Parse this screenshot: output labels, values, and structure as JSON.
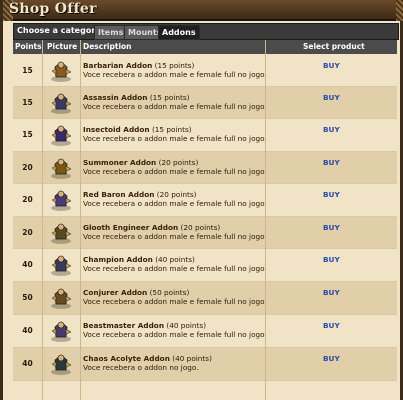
{
  "window": {
    "title": "Shop Offer"
  },
  "categories": {
    "label": "Choose a categorie:",
    "tabs": [
      {
        "label": "Items",
        "active": false
      },
      {
        "label": "Mounts",
        "active": false
      },
      {
        "label": "Addons",
        "active": true
      }
    ]
  },
  "table": {
    "headers": {
      "points": "Points",
      "picture": "Picture",
      "description": "Description",
      "select": "Select product"
    },
    "rows": [
      {
        "points": "15",
        "name": "Barbarian Addon",
        "pts_text": "(15 points)",
        "desc": "Voce recebera o addon male e female full no jogo.",
        "buy": "BUY",
        "icon": "barbarian-outfit-icon"
      },
      {
        "points": "15",
        "name": "Assassin Addon",
        "pts_text": "(15 points)",
        "desc": "Voce recebera o addon male e female full no jogo.",
        "buy": "BUY",
        "icon": "assassin-outfit-icon"
      },
      {
        "points": "15",
        "name": "Insectoid Addon",
        "pts_text": "(15 points)",
        "desc": "Voce recebera o addon male e female full no jogo.",
        "buy": "BUY",
        "icon": "insectoid-outfit-icon"
      },
      {
        "points": "20",
        "name": "Summoner Addon",
        "pts_text": "(20 points)",
        "desc": "Voce recebera o addon male e female full no jogo.",
        "buy": "BUY",
        "icon": "summoner-outfit-icon"
      },
      {
        "points": "20",
        "name": "Red Baron Addon",
        "pts_text": "(20 points)",
        "desc": "Voce recebera o addon male e female full no jogo.",
        "buy": "BUY",
        "icon": "red-baron-outfit-icon"
      },
      {
        "points": "20",
        "name": "Glooth Engineer Addon",
        "pts_text": "(20 points)",
        "desc": "Voce recebera o addon male e female full no jogo.",
        "buy": "BUY",
        "icon": "glooth-engineer-outfit-icon"
      },
      {
        "points": "40",
        "name": "Champion Addon",
        "pts_text": "(40 points)",
        "desc": "Voce recebera o addon male e female full no jogo.",
        "buy": "BUY",
        "icon": "champion-outfit-icon"
      },
      {
        "points": "50",
        "name": "Conjurer Addon",
        "pts_text": "(50 points)",
        "desc": "Voce recebera o addon male e female full no jogo.",
        "buy": "BUY",
        "icon": "conjurer-outfit-icon"
      },
      {
        "points": "40",
        "name": "Beastmaster Addon",
        "pts_text": "(40 points)",
        "desc": "Voce recebera o addon male e female full no jogo.",
        "buy": "BUY",
        "icon": "beastmaster-outfit-icon"
      },
      {
        "points": "40",
        "name": "Chaos Acolyte Addon",
        "pts_text": "(40 points)",
        "desc": "Voce recebera o addon no jogo.",
        "buy": "BUY",
        "icon": "chaos-acolyte-outfit-icon"
      }
    ]
  },
  "colors": {
    "buy_link": "#2a4aa8",
    "row_odd": "#f1e3c6",
    "row_even": "#e1cfaa",
    "header_bg": "#4b4b4b"
  }
}
